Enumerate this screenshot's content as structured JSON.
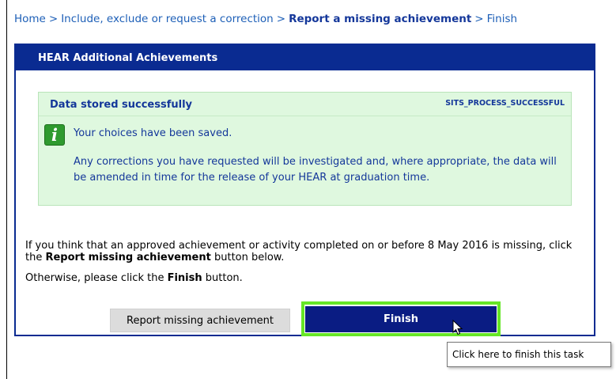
{
  "breadcrumb": {
    "home": "Home",
    "include": "Include, exclude or request a correction",
    "current": "Report a missing achievement",
    "finish": "Finish",
    "separator": ">"
  },
  "panel": {
    "title": "HEAR Additional Achievements"
  },
  "message": {
    "title": "Data stored successfully",
    "code": "SITS_PROCESS_SUCCESSFUL",
    "icon": "info-icon",
    "line1": "Your choices have been saved.",
    "line2": "Any corrections you have requested will be investigated and, where appropriate, the data will be amended in time for the release of your HEAR at graduation time."
  },
  "body": {
    "p1_start": "If you think that an approved achievement or activity completed on or before 8 May 2016 is missing, click the ",
    "p1_bold": "Report missing achievement",
    "p1_end": " button below.",
    "p2_start": "Otherwise, please click the ",
    "p2_bold": "Finish",
    "p2_end": " button."
  },
  "buttons": {
    "report": "Report missing achievement",
    "finish": "Finish"
  },
  "tooltip": {
    "text": "Click here to finish this task"
  },
  "colors": {
    "navy": "#0a2b91",
    "finish_button": "#0a1c83",
    "success_bg": "#dff8df",
    "highlight_outline": "#66e626",
    "link": "#1d5fb7"
  }
}
